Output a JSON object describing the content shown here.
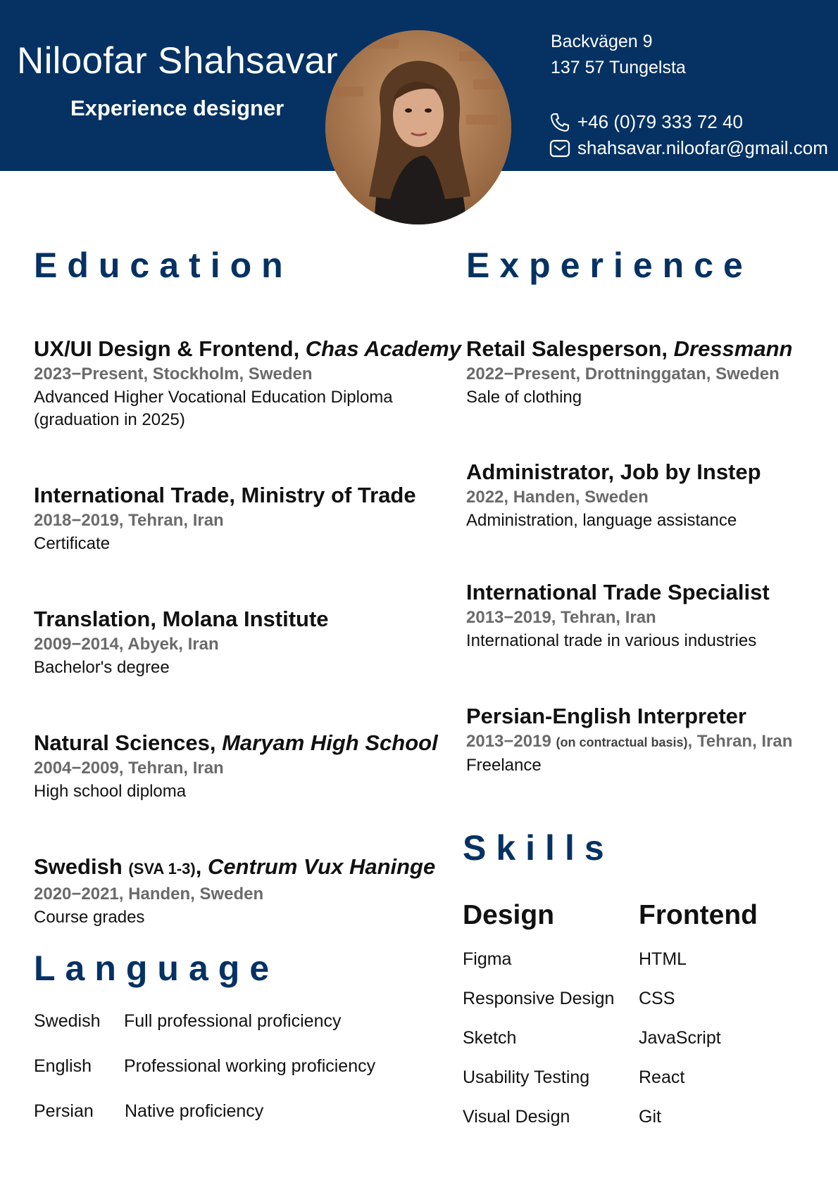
{
  "header": {
    "name": "Niloofar Shahsavar",
    "role": "Experience designer",
    "address_line1": "Backvägen 9",
    "address_line2": "137 57 Tungelsta",
    "phone": "+46 (0)79 333 72 40",
    "email": "shahsavar.niloofar@gmail.com",
    "icons": [
      "phone-icon",
      "mail-icon"
    ],
    "background_color": "#053263"
  },
  "education": {
    "title": "Education",
    "entries": [
      {
        "title": "UX/UI Design & Frontend, ",
        "org": "Chas Academy",
        "meta": "2023−Present, Stockholm, Sweden",
        "desc1": "Advanced Higher Vocational Education Diploma",
        "desc2": "(graduation in 2025)"
      },
      {
        "title": "International Trade, Ministry of Trade",
        "meta": "2018−2019, Tehran, Iran",
        "desc1": "Certificate"
      },
      {
        "title": "Translation, Molana Institute",
        "meta": "2009−2014, Abyek, Iran",
        "desc1": "Bachelor's degree"
      },
      {
        "title": "Natural Sciences, ",
        "org": "Maryam High School",
        "meta": "2004−2009, Tehran, Iran",
        "desc1": "High school diploma"
      },
      {
        "title": "Swedish ",
        "title_small": "(SVA 1-3)",
        "title_sep": ", ",
        "org": "Centrum Vux Haninge",
        "meta": "2020−2021, Handen, Sweden",
        "desc1": "Course grades"
      }
    ]
  },
  "experience": {
    "title": "Experience",
    "entries": [
      {
        "title": "Retail Salesperson, ",
        "org": "Dressmann",
        "meta": "2022−Present, Drottninggatan, Sweden",
        "desc1": "Sale of clothing"
      },
      {
        "title": "Administrator, Job by Instep",
        "meta": "2022, Handen, Sweden",
        "desc1": "Administration, language assistance"
      },
      {
        "title": "International Trade Specialist",
        "meta": "2013−2019, Tehran, Iran",
        "desc1": "International trade in various industries"
      },
      {
        "title": "Persian-English Interpreter",
        "meta_pre": "2013−2019 ",
        "meta_small": "(on contractual basis)",
        "meta_post": ", Tehran, Iran",
        "desc1": "Freelance"
      }
    ]
  },
  "language": {
    "title": "Language",
    "rows": [
      {
        "lang": "Swedish",
        "level": "Full professional proficiency"
      },
      {
        "lang": "English",
        "level": "Professional working proficiency"
      },
      {
        "lang": "Persian",
        "level": "Native proficiency"
      }
    ]
  },
  "skills": {
    "title": "Skills",
    "design_title": "Design",
    "frontend_title": "Frontend",
    "design": [
      "Figma",
      "Responsive Design",
      "Sketch",
      "Usability Testing",
      "Visual Design"
    ],
    "frontend": [
      "HTML",
      "CSS",
      "JavaScript",
      "React",
      "Git"
    ]
  }
}
